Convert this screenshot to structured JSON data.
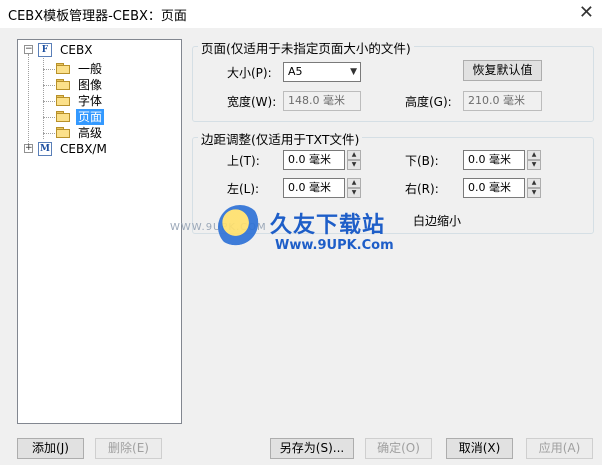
{
  "window": {
    "title": "CEBX模板管理器-CEBX：页面",
    "close_glyph": "✕"
  },
  "tree": {
    "root": {
      "label": "CEBX",
      "icon_letter": "F",
      "expander": "−"
    },
    "children": [
      {
        "label": "一般"
      },
      {
        "label": "图像"
      },
      {
        "label": "字体"
      },
      {
        "label": "页面"
      },
      {
        "label": "高级"
      }
    ],
    "second_root": {
      "label": "CEBX/M",
      "icon_letter": "M",
      "expander": "+"
    }
  },
  "page_group": {
    "legend": "页面(仅适用于未指定页面大小的文件)",
    "size_label": "大小(P):",
    "size_value": "A5",
    "restore_default_label": "恢复默认值",
    "width_label": "宽度(W):",
    "width_value": "148.0 毫米",
    "height_label": "高度(G):",
    "height_value": "210.0 毫米"
  },
  "margin_group": {
    "legend": "边距调整(仅适用于TXT文件)",
    "top_label": "上(T):",
    "top_value": "0.0 毫米",
    "bottom_label": "下(B):",
    "bottom_value": "0.0 毫米",
    "left_label": "左(L):",
    "left_value": "0.0 毫米",
    "right_label": "右(R):",
    "right_value": "0.0 毫米",
    "shrink_label": "白边缩小"
  },
  "watermark": {
    "main_text": "久友下载站",
    "sub_text": "Www.9UPK.Com",
    "side_text": "WWW.9UPK.COM"
  },
  "footer": {
    "add_label": "添加(J)",
    "delete_label": "删除(E)",
    "save_as_label": "另存为(S)...",
    "ok_label": "确定(O)",
    "cancel_label": "取消(X)",
    "apply_label": "应用(A)"
  }
}
